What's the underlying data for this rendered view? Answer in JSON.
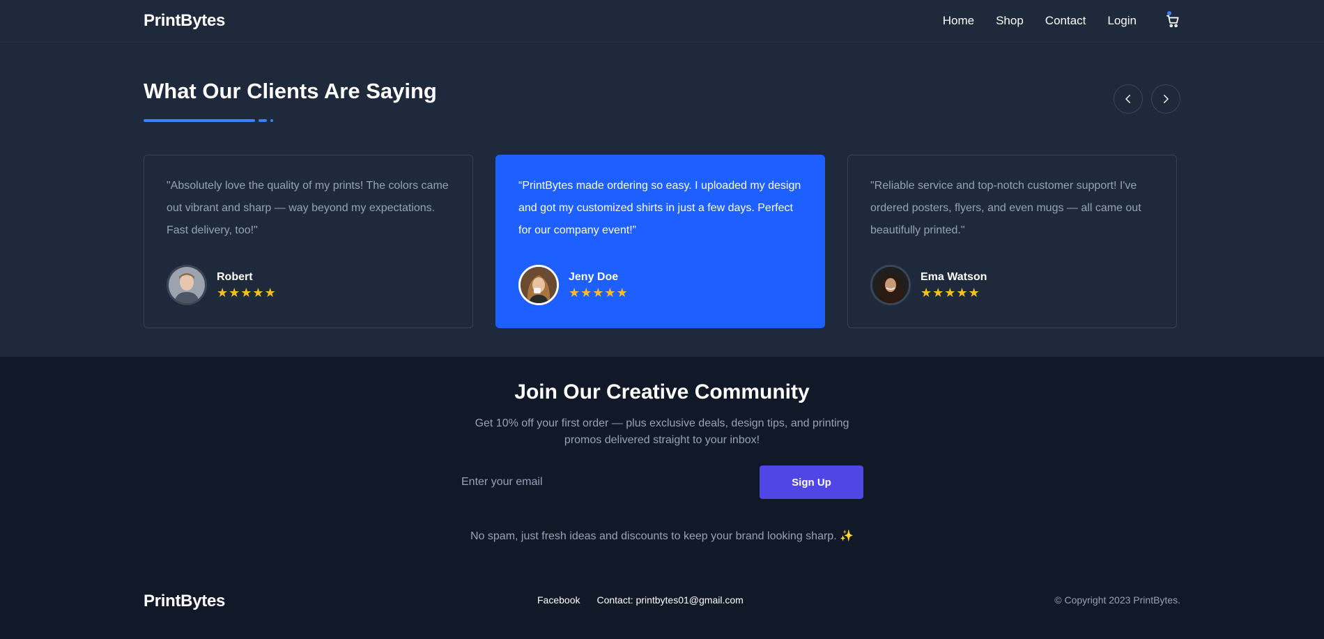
{
  "nav": {
    "logo": "PrintBytes",
    "links": [
      "Home",
      "Shop",
      "Contact",
      "Login"
    ],
    "cart_icon": "cart-icon"
  },
  "testimonials": {
    "title": "What Our Clients Are Saying",
    "prev_icon": "chevron-left-icon",
    "next_icon": "chevron-right-icon",
    "items": [
      {
        "quote": "\"Absolutely love the quality of my prints! The colors came out vibrant and sharp — way beyond my expectations. Fast delivery, too!\"",
        "name": "Robert",
        "rating": 5
      },
      {
        "quote": "“PrintBytes made ordering so easy. I uploaded my design and got my customized shirts in just a few days. Perfect for our company event!”",
        "name": "Jeny Doe",
        "rating": 5
      },
      {
        "quote": "\"Reliable service and top-notch customer support! I've ordered posters, flyers, and even mugs — all came out beautifully printed.\"",
        "name": "Ema Watson",
        "rating": 5
      }
    ],
    "star_color": "#fbbf24",
    "active_color": "#1d5fff"
  },
  "newsletter": {
    "title": "Join Our Creative Community",
    "subtitle": "Get 10% off your first order — plus exclusive deals, design tips, and printing promos delivered straight to your inbox!",
    "email_placeholder": "Enter your email",
    "email_value": "",
    "signup_label": "Sign Up",
    "note": "No spam, just fresh ideas and discounts to keep your brand looking sharp. ✨",
    "button_color": "#4f46e5"
  },
  "footer": {
    "logo": "PrintBytes",
    "facebook": "Facebook",
    "contact": "Contact: printbytes01@gmail.com",
    "copyright": "© Copyright 2023 PrintBytes."
  }
}
